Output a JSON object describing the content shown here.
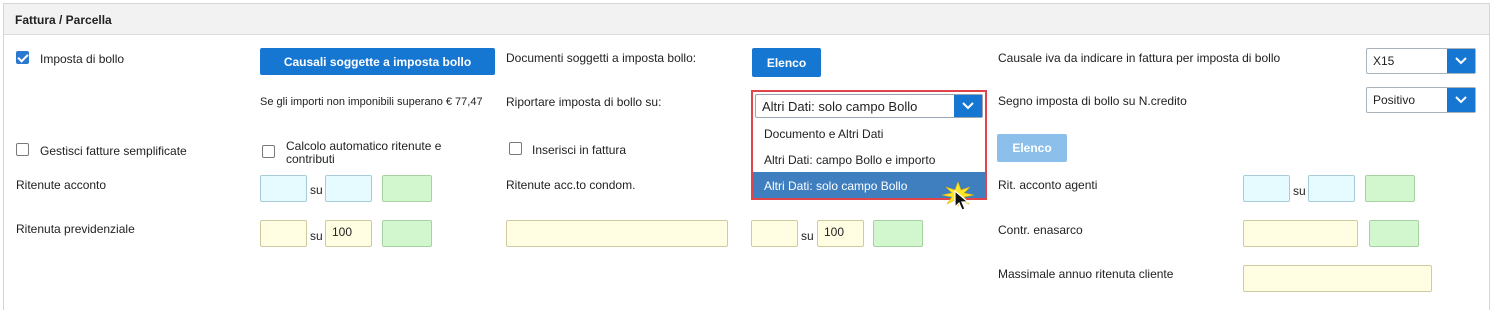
{
  "panel": {
    "title": "Fattura / Parcella"
  },
  "col1": {
    "imposta_bollo": {
      "label": "Imposta di bollo",
      "checked": true
    },
    "causali_button": "Causali soggette a imposta bollo",
    "soglia_note": "Se gli importi non imponibili superano € 77,47",
    "fatture_semplificate": {
      "label": "Gestisci fatture semplificate",
      "checked": false
    },
    "calcolo_auto": {
      "label_line1": "Calcolo automatico ritenute e",
      "label_line2": "contributi",
      "checked": false
    },
    "ritenute_acconto": {
      "label": "Ritenute acconto",
      "su": "su",
      "value1": "",
      "value2": "",
      "value3": ""
    },
    "ritenuta_previdenziale": {
      "label": "Ritenuta previdenziale",
      "su": "su",
      "value1": "",
      "value2": "100",
      "value3": ""
    }
  },
  "col2": {
    "documenti_label": "Documenti soggetti a imposta bollo:",
    "elenco_button": "Elenco",
    "riportare_label": "Riportare imposta di bollo su:",
    "riportare_select": {
      "value": "Altri Dati: solo campo Bollo",
      "options": [
        "Documento e Altri Dati",
        "Altri Dati: campo Bollo e importo",
        "Altri Dati: solo campo Bollo"
      ],
      "selected_index": 2
    },
    "inserisci_fattura": {
      "label": "Inserisci in fattura",
      "checked": false
    },
    "ritenute_condom": {
      "label": "Ritenute acc.to condom."
    },
    "condom_extra": {
      "su": "su",
      "value1": "",
      "value2": "100",
      "value3": ""
    }
  },
  "col3": {
    "causale_iva_label": "Causale iva da indicare in fattura per imposta di bollo",
    "causale_iva_value": "X15",
    "segno_label": "Segno imposta di bollo su N.credito",
    "segno_value": "Positivo",
    "elenco_button": "Elenco",
    "rit_agenti": {
      "label": "Rit. acconto agenti",
      "su": "su"
    },
    "contr_enasarco": {
      "label": "Contr. enasarco"
    },
    "massimale": {
      "label": "Massimale annuo ritenuta cliente"
    }
  },
  "colors": {
    "primary": "#1677d2",
    "highlight_border": "#e0454b",
    "dropdown_active": "#3f7fc0"
  }
}
